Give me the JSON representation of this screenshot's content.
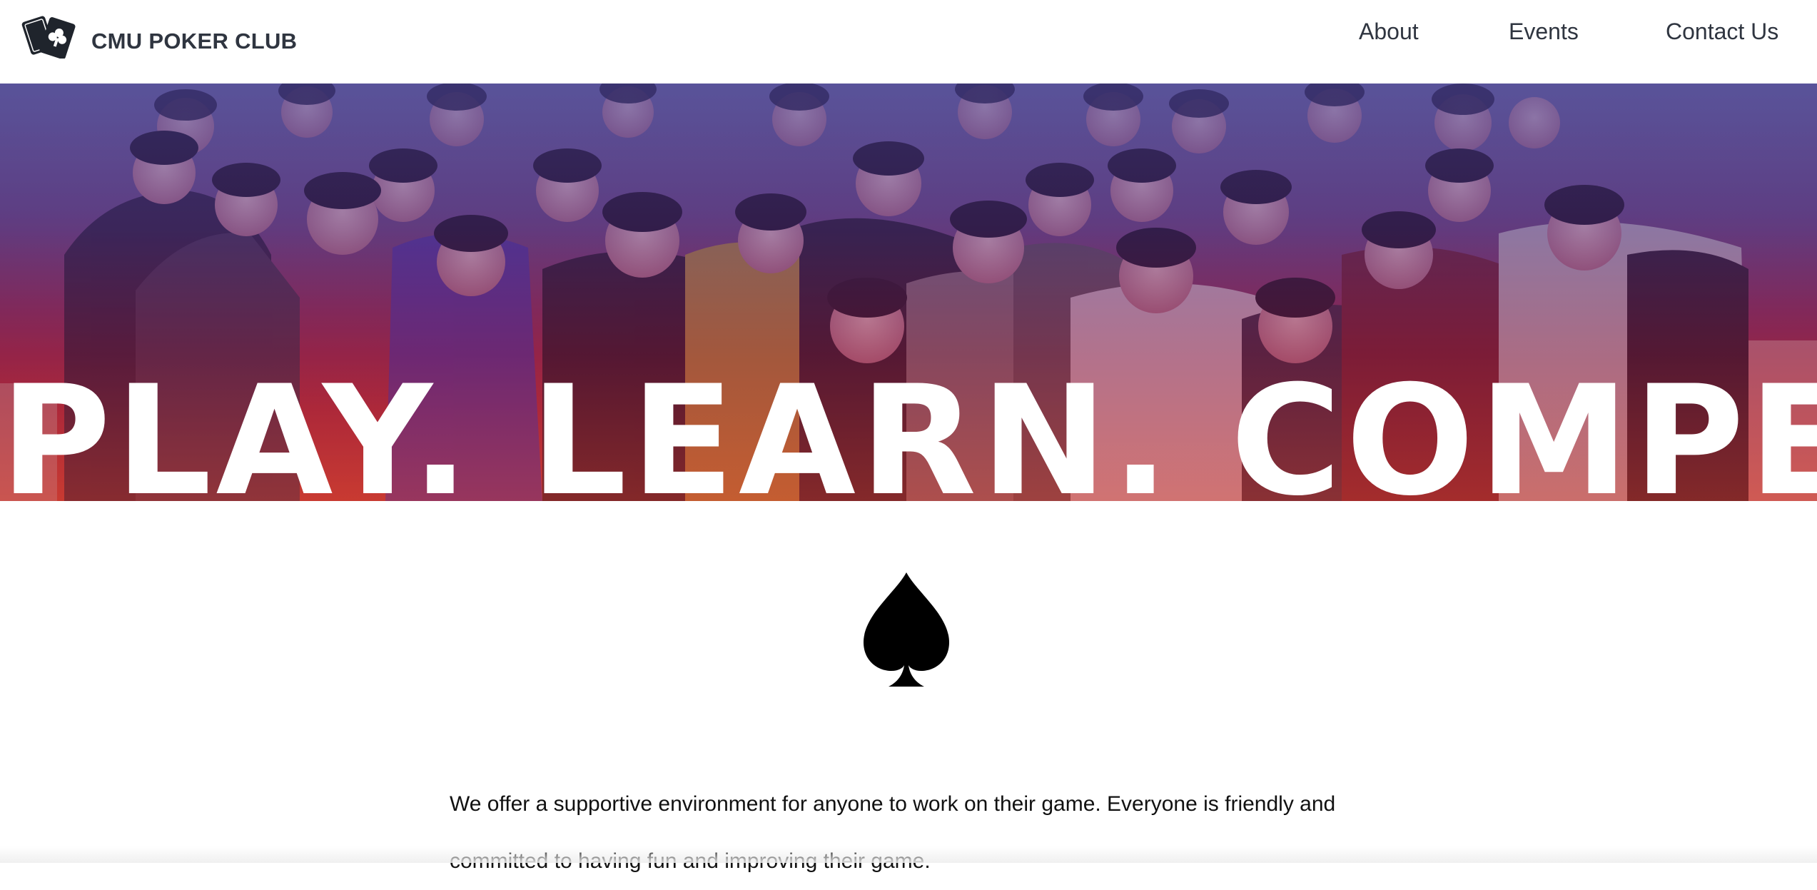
{
  "header": {
    "logo_icon": "playing-cards-logo-icon",
    "brand": "CMU POKER CLUB",
    "nav": {
      "about": "About",
      "events": "Events",
      "contact": "Contact Us"
    }
  },
  "hero": {
    "image": "group-photo-of-club-members",
    "headline": "PLAY. LEARN. COMPETE.",
    "tint_colors": [
      "#4a40a0",
      "#8c1c3c",
      "#cd3228"
    ]
  },
  "content": {
    "divider_icon": "spade-icon",
    "intro": "We offer a supportive environment for anyone to work on their game. Everyone is friendly and committed to having fun and improving their game."
  },
  "colors": {
    "text_dark": "#2f3540",
    "headline": "#ffffff",
    "background": "#ffffff"
  }
}
